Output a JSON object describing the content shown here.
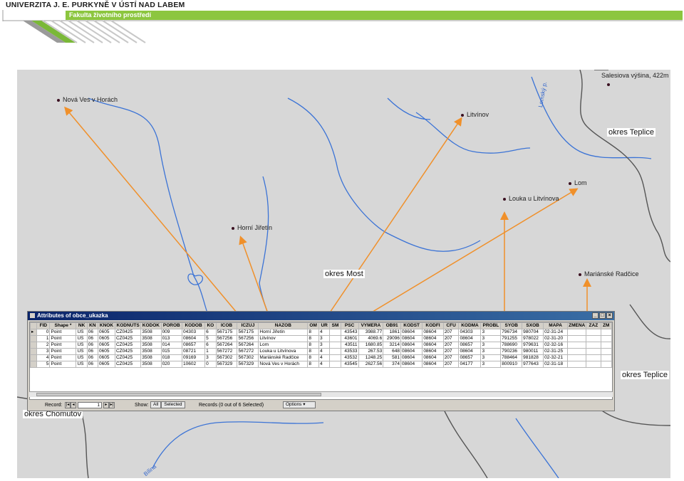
{
  "header": {
    "university": "UNIVERZITA J. E. PURKYNĚ V ÚSTÍ NAD LABEM",
    "faculty": "Fakulta životního prostředí"
  },
  "map": {
    "places": [
      {
        "name": "Nová Ves v Horách"
      },
      {
        "name": "Litvínov"
      },
      {
        "name": "Horní Jiřetín"
      },
      {
        "name": "Lom"
      },
      {
        "name": "Louka u Litvínova"
      },
      {
        "name": "Mariánské Radčice"
      },
      {
        "name": "Salesiova výšina, 422m"
      }
    ],
    "districts": [
      "okres Teplice",
      "okres Most",
      "okres Chomutov",
      "okres Teplice"
    ],
    "rivers": [
      "Lomský p.",
      "Bílina"
    ],
    "colors": {
      "background": "#d7d7d7",
      "river": "#3b73d6",
      "border": "#555555",
      "arrow": "#f0902a"
    }
  },
  "attribute_window": {
    "title": "Attributes of obce_ukazka",
    "columns": [
      "FID",
      "Shape *",
      "NK",
      "KN",
      "KNOK",
      "KODNUTS",
      "KODOK",
      "POROB",
      "KODOB",
      "KO",
      "ICOB",
      "ICZUJ",
      "NAZOB",
      "OM",
      "UR",
      "SM",
      "PSC",
      "VYMERA",
      "OB91",
      "KODST",
      "KODFI",
      "CFU",
      "KODMA",
      "PROBL",
      "SYOB",
      "SXOB",
      "MAPA",
      "ZMENA",
      "ZAZ",
      "ZM"
    ],
    "rows": [
      [
        "0",
        "Point",
        "US",
        "06",
        "0605",
        "CZ0425",
        "3508",
        "009",
        "04303",
        "6",
        "567175",
        "567175",
        "Horní Jiřetín",
        "8",
        "4",
        "",
        "43543",
        "3988.77",
        "1861",
        "08604",
        "08604",
        "207",
        "04303",
        "3",
        "796734",
        "980704",
        "02-31-24",
        "",
        "",
        ""
      ],
      [
        "1",
        "Point",
        "US",
        "06",
        "0605",
        "CZ0425",
        "3508",
        "013",
        "08604",
        "5",
        "567256",
        "567256",
        "Litvínov",
        "8",
        "3",
        "",
        "43601",
        "4069.6",
        "29096",
        "08604",
        "08604",
        "207",
        "08604",
        "3",
        "791255",
        "978022",
        "02-31-20",
        "",
        "",
        ""
      ],
      [
        "2",
        "Point",
        "US",
        "06",
        "0605",
        "CZ0425",
        "3508",
        "014",
        "08657",
        "6",
        "567264",
        "567264",
        "Lom",
        "8",
        "3",
        "",
        "43511",
        "1680.85",
        "3214",
        "08604",
        "08604",
        "207",
        "08657",
        "3",
        "788690",
        "979631",
        "02-32-16",
        "",
        "",
        ""
      ],
      [
        "3",
        "Point",
        "US",
        "06",
        "0605",
        "CZ0425",
        "3508",
        "015",
        "08721",
        "1",
        "567272",
        "567272",
        "Louka u Litvínova",
        "8",
        "4",
        "",
        "43533",
        "267.53",
        "648",
        "08604",
        "08604",
        "207",
        "08604",
        "3",
        "790236",
        "980011",
        "02-31-25",
        "",
        "",
        ""
      ],
      [
        "4",
        "Point",
        "US",
        "06",
        "0605",
        "CZ0425",
        "3508",
        "018",
        "09169",
        "3",
        "567302",
        "567302",
        "Mariánské Radčice",
        "8",
        "4",
        "",
        "43532",
        "1248.25",
        "581",
        "08604",
        "08604",
        "207",
        "08657",
        "3",
        "788464",
        "981828",
        "02-32-21",
        "",
        "",
        ""
      ],
      [
        "5",
        "Point",
        "US",
        "06",
        "0605",
        "CZ0425",
        "3508",
        "020",
        "10602",
        "0",
        "567329",
        "567329",
        "Nová Ves v Horách",
        "8",
        "4",
        "",
        "43545",
        "2627.56",
        "374",
        "08604",
        "08604",
        "207",
        "04177",
        "3",
        "800910",
        "977643",
        "02-31-18",
        "",
        "",
        ""
      ]
    ],
    "status": {
      "record_label": "Record:",
      "record_value": "1",
      "show_label": "Show:",
      "all_button": "All",
      "selected_button": "Selected",
      "records_text": "Records (0 out of 6 Selected)",
      "options_button": "Options"
    }
  }
}
